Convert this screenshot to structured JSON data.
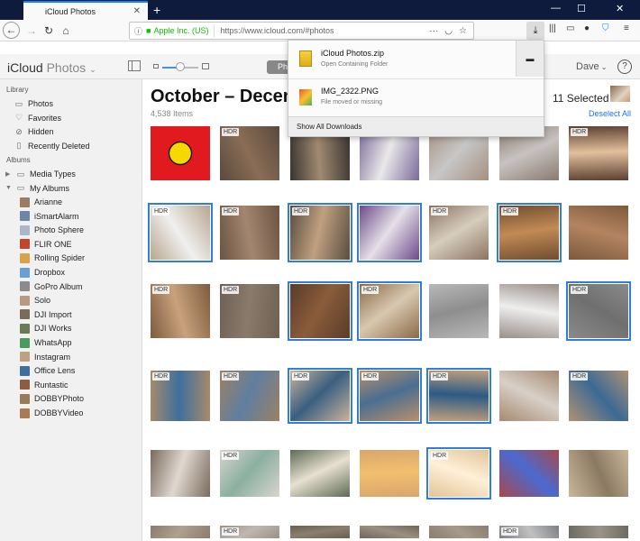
{
  "browser": {
    "tab_title": "iCloud Photos",
    "tab_close": "✕",
    "new_tab": "+",
    "win_min": "—",
    "win_max": "☐",
    "win_close": "✕",
    "org": "Apple Inc. (US)",
    "url": "https://www.icloud.com/#photos",
    "icons": [
      "back-icon",
      "forward-icon",
      "reload-icon",
      "home-icon",
      "info-icon",
      "lock-icon",
      "page-actions-icon",
      "pocket-icon",
      "bookmark-star-icon",
      "downloads-icon",
      "library-icon",
      "reader-icon",
      "account-icon",
      "tracking-shield-icon",
      "menu-icon"
    ]
  },
  "downloads": {
    "items": [
      {
        "name": "iCloud Photos.zip",
        "status": "Open Containing Folder"
      },
      {
        "name": "IMG_2322.PNG",
        "status": "File moved or missing"
      }
    ],
    "show_all": "Show All Downloads"
  },
  "app": {
    "logo_main": "iCloud",
    "logo_sub": "Photos",
    "segment_label": "Photos",
    "user": "Dave",
    "help": "?"
  },
  "sidebar": {
    "library_header": "Library",
    "library": [
      "Photos",
      "Favorites",
      "Hidden",
      "Recently Deleted"
    ],
    "albums_header": "Albums",
    "groups": [
      "Media Types",
      "My Albums"
    ],
    "albums": [
      "Arianne",
      "iSmartAlarm",
      "Photo Sphere",
      "FLIR ONE",
      "Rolling Spider",
      "Dropbox",
      "GoPro Album",
      "Solo",
      "DJI Import",
      "DJI Works",
      "WhatsApp",
      "Instagram",
      "Office Lens",
      "Runtastic",
      "DOBBYPhoto",
      "DOBBYVideo"
    ]
  },
  "main": {
    "title": "October – December",
    "count": "4,538 Items",
    "selected": "11 Selected",
    "deselect": "Deselect All",
    "hdr_label": "HDR"
  },
  "colors": {
    "accent": "#2f7fd8",
    "titlebar": "#0e1b3d",
    "link": "#1a73e8",
    "secure_green": "#12bc00"
  }
}
